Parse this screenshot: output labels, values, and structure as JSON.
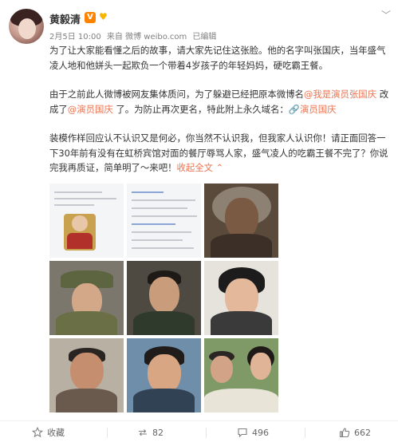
{
  "post": {
    "author": "黄毅清",
    "verified_badge": "V",
    "meta": {
      "date": "2月5日 10:00",
      "source": "来自 微博 weibo.com",
      "edited": "已编辑"
    },
    "paragraphs": [
      {
        "segments": [
          {
            "text": "为了让大家能看懂之后的故事，请大家先记住这张脸。他的名字叫张国庆，当年盛气凌人地和他姘头一起欺负一个带着4岁孩子的年轻妈妈，硬吃霸王餐。",
            "link": false
          }
        ]
      },
      {
        "segments": [
          {
            "text": "由于之前此人微博被网友集体质问，为了躲避已经把原本微博名",
            "link": false
          },
          {
            "text": "@我是演员张国庆",
            "link": true
          },
          {
            "text": " 改成了",
            "link": false
          },
          {
            "text": "@演员国庆",
            "link": true
          },
          {
            "text": " 了。为防止再次更名，特此附上永久域名：",
            "link": false
          },
          {
            "text": "🔗演员国庆",
            "link": true
          }
        ]
      },
      {
        "segments": [
          {
            "text": "装模作样回应认不认识又是何必，你当然不认识我，但我家人认识你！请正面回答一下30年前有没有在虹桥宾馆对面的餐厅辱骂人家，盛气凌人的吃霸王餐不完了？你说完我再质证，简单明了～来吧！",
            "link": false
          },
          {
            "text": "收起全文",
            "link": true
          },
          {
            "text": " ⌃",
            "link": true
          }
        ]
      }
    ]
  },
  "icons": {
    "favorite": "star-outline-icon",
    "repost": "repost-icon",
    "comment": "comment-icon",
    "like": "thumbs-up-icon",
    "more": "chevron-down-icon"
  },
  "actions": {
    "favorite_label": "收藏",
    "repost_count": "82",
    "comment_count": "496",
    "like_count": "662"
  },
  "colors": {
    "link": "#eb7350",
    "vip": "#ff8200",
    "text": "#333333",
    "meta": "#808080"
  }
}
